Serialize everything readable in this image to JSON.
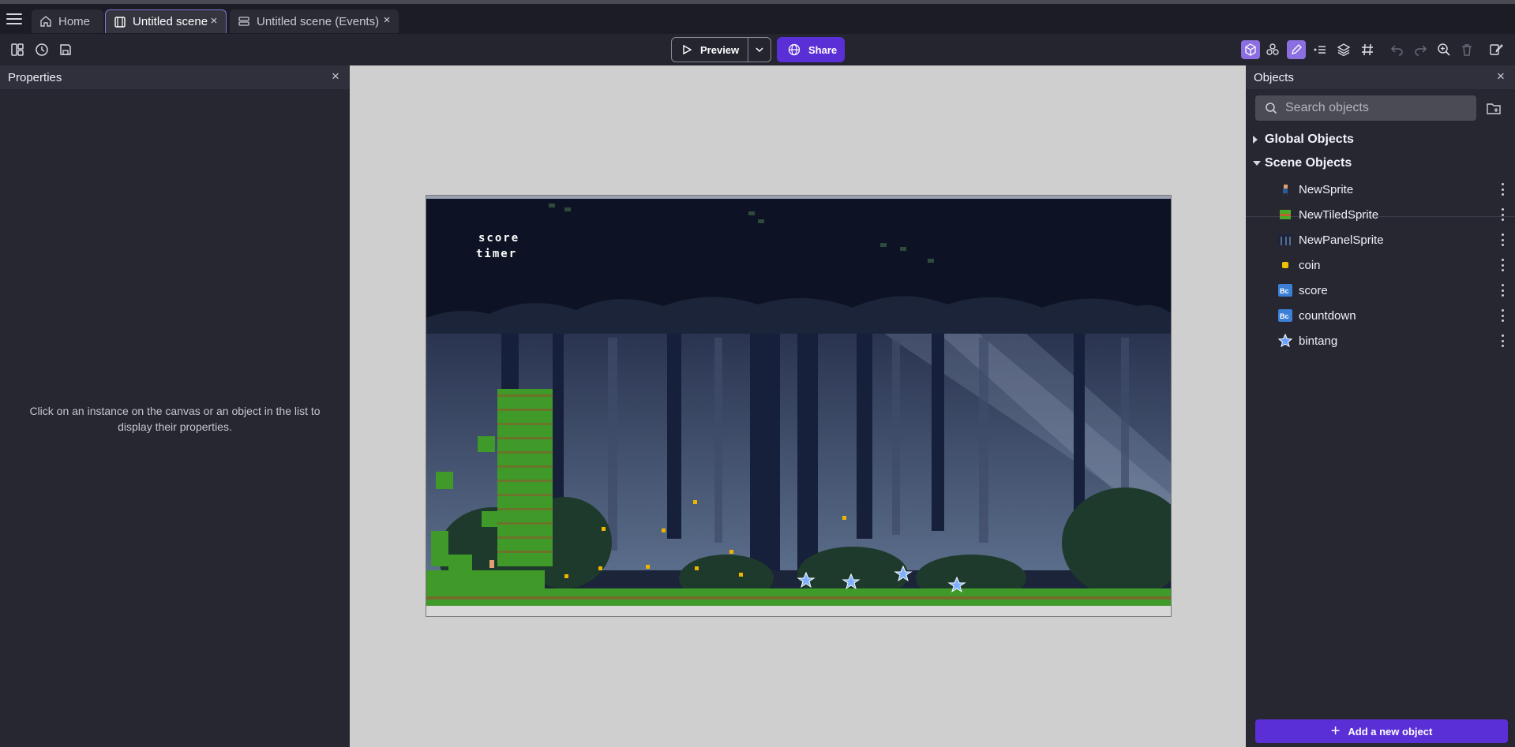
{
  "tabs": [
    {
      "label": "Home",
      "icon": "home-icon",
      "active": false
    },
    {
      "label": "Untitled scene",
      "icon": "scene-icon",
      "active": true
    },
    {
      "label": "Untitled scene (Events)",
      "icon": "events-icon",
      "active": false
    }
  ],
  "toolbar": {
    "preview_label": "Preview",
    "share_label": "Share"
  },
  "properties": {
    "title": "Properties",
    "empty_text": "Click on an instance on the canvas or an object in the list to display their properties."
  },
  "scene": {
    "hud_score": "score",
    "hud_timer": "timer"
  },
  "objects": {
    "title": "Objects",
    "search_placeholder": "Search objects",
    "global_group": "Global Objects",
    "scene_group": "Scene Objects",
    "items": [
      {
        "label": "NewSprite",
        "icon": "character-sprite-icon"
      },
      {
        "label": "NewTiledSprite",
        "icon": "grass-tile-icon"
      },
      {
        "label": "NewPanelSprite",
        "icon": "forest-panel-icon"
      },
      {
        "label": "coin",
        "icon": "coin-icon"
      },
      {
        "label": "score",
        "icon": "text-object-icon"
      },
      {
        "label": "countdown",
        "icon": "text-object-icon"
      },
      {
        "label": "bintang",
        "icon": "star-icon"
      }
    ],
    "add_label": "Add a new object"
  },
  "colors": {
    "accent": "#5b2fd6",
    "selected_tool": "#8b6fe0",
    "canvas_bg": "#cfcfcf",
    "scene_sky": "#0d1324"
  }
}
